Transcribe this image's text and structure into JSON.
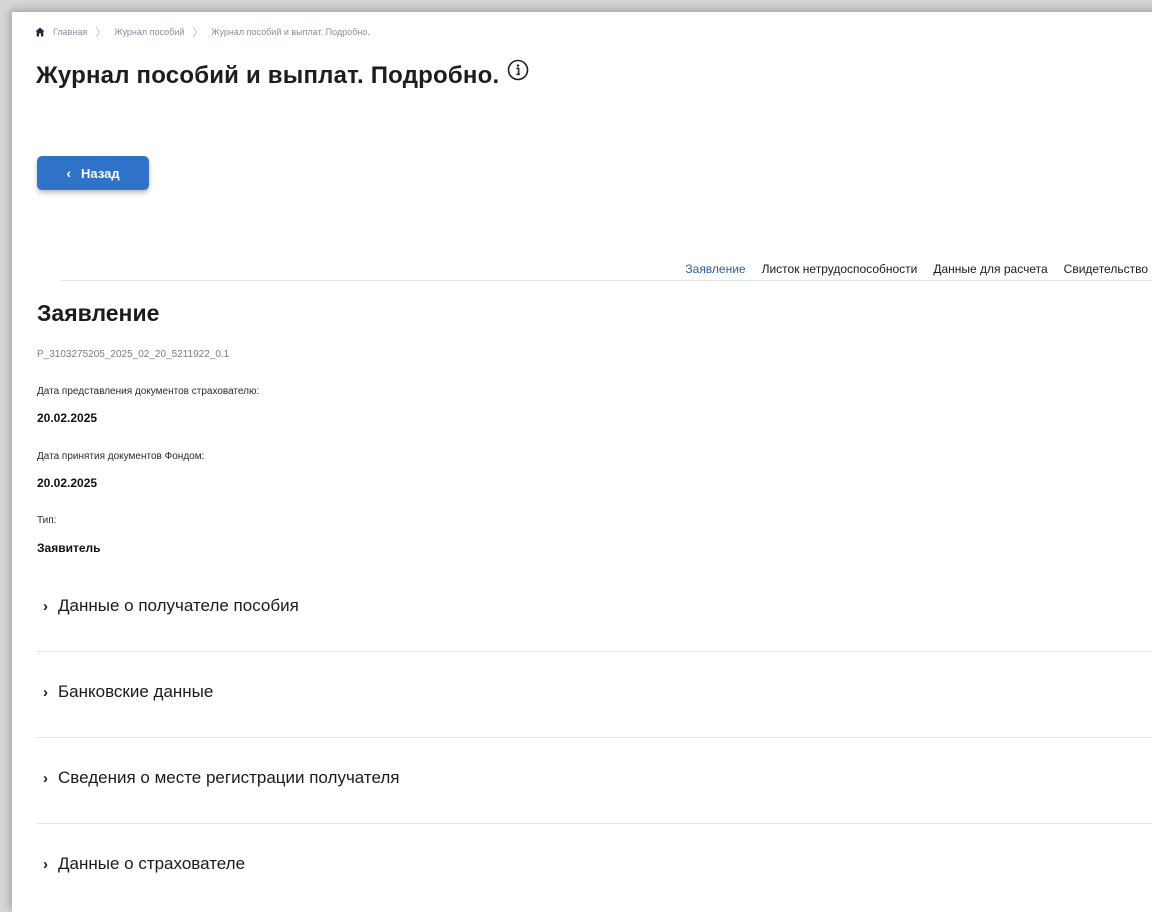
{
  "breadcrumb": {
    "items": [
      "Главная",
      "Журнал пособий",
      "Журнал пособий и выплат. Подробно."
    ],
    "separator": "〉"
  },
  "page": {
    "title": "Журнал пособий и выплат. Подробно.",
    "info_icon": "info-circle-icon"
  },
  "back_button": {
    "label": "Назад",
    "icon": "chevron-left-icon"
  },
  "tabs": [
    {
      "label": "Заявление",
      "active": true
    },
    {
      "label": "Листок нетрудоспособности",
      "active": false
    },
    {
      "label": "Данные для расчета",
      "active": false
    },
    {
      "label": "Свидетельство",
      "active": false
    }
  ],
  "section": {
    "title": "Заявление",
    "doc_id": "P_3103275205_2025_02_20_5211922_0.1",
    "fields": [
      {
        "label": "Дата представления документов страхователю:",
        "value": "20.02.2025"
      },
      {
        "label": "Дата принятия документов Фондом:",
        "value": "20.02.2025"
      },
      {
        "label": "Тип:",
        "value": "Заявитель"
      }
    ]
  },
  "accordion": [
    {
      "label": "Данные о получателе пособия"
    },
    {
      "label": "Банковские данные"
    },
    {
      "label": "Сведения о месте регистрации получателя"
    },
    {
      "label": "Данные о страхователе"
    }
  ],
  "colors": {
    "accent": "#2f73c9",
    "active_tab": "#2f5e9e",
    "divider": "#dde7f0"
  }
}
